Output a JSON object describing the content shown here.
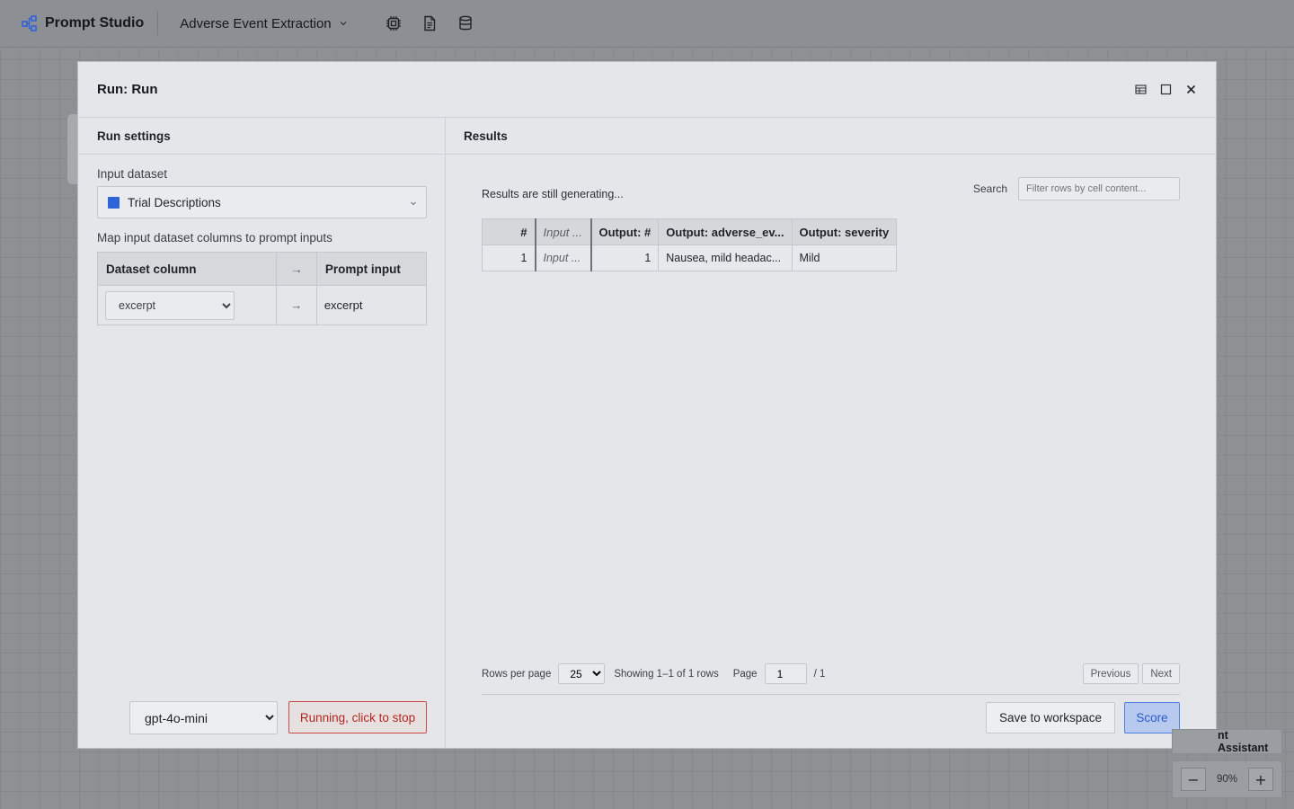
{
  "app": {
    "name": "Prompt Studio",
    "project": "Adverse Event Extraction"
  },
  "toolbar_icons": [
    "processor-icon",
    "document-icon",
    "database-icon"
  ],
  "modal": {
    "title": "Run: Run",
    "controls": [
      "table-view-icon",
      "maximize-icon",
      "close-icon"
    ],
    "left": {
      "heading": "Run settings",
      "input_dataset_label": "Input dataset",
      "dataset": {
        "name": "Trial Descriptions",
        "color": "#2f63d9"
      },
      "map_label": "Map input dataset columns to prompt inputs",
      "map_headers": {
        "dataset_column": "Dataset column",
        "arrow": "→",
        "prompt_input": "Prompt input"
      },
      "mapping": {
        "column": "excerpt",
        "arrow": "→",
        "prompt_input": "excerpt"
      },
      "model": "gpt-4o-mini",
      "stop_button": "Running, click to stop"
    },
    "right": {
      "heading": "Results",
      "status": "Results are still generating...",
      "search_label": "Search",
      "search_placeholder": "Filter rows by cell content...",
      "columns": [
        "#",
        "Input ...",
        "Output: #",
        "Output: adverse_ev...",
        "Output: severity"
      ],
      "rows": [
        {
          "num": "1",
          "input": "Input ...",
          "output_num": "1",
          "adverse_events": "Nausea, mild headac...",
          "severity": "Mild"
        }
      ],
      "pager": {
        "rows_per_page_label": "Rows per page",
        "rows_per_page": "25",
        "showing": "Showing 1–1 of 1 rows",
        "page_label": "Page",
        "page": "1",
        "of_pages": "/ 1",
        "previous": "Previous",
        "next": "Next"
      },
      "save_button": "Save to workspace",
      "score_button": "Score"
    }
  },
  "background": {
    "assistant_tab": "nt Assistant",
    "zoom": {
      "minus": "−",
      "value": "90%",
      "plus": "+"
    }
  }
}
